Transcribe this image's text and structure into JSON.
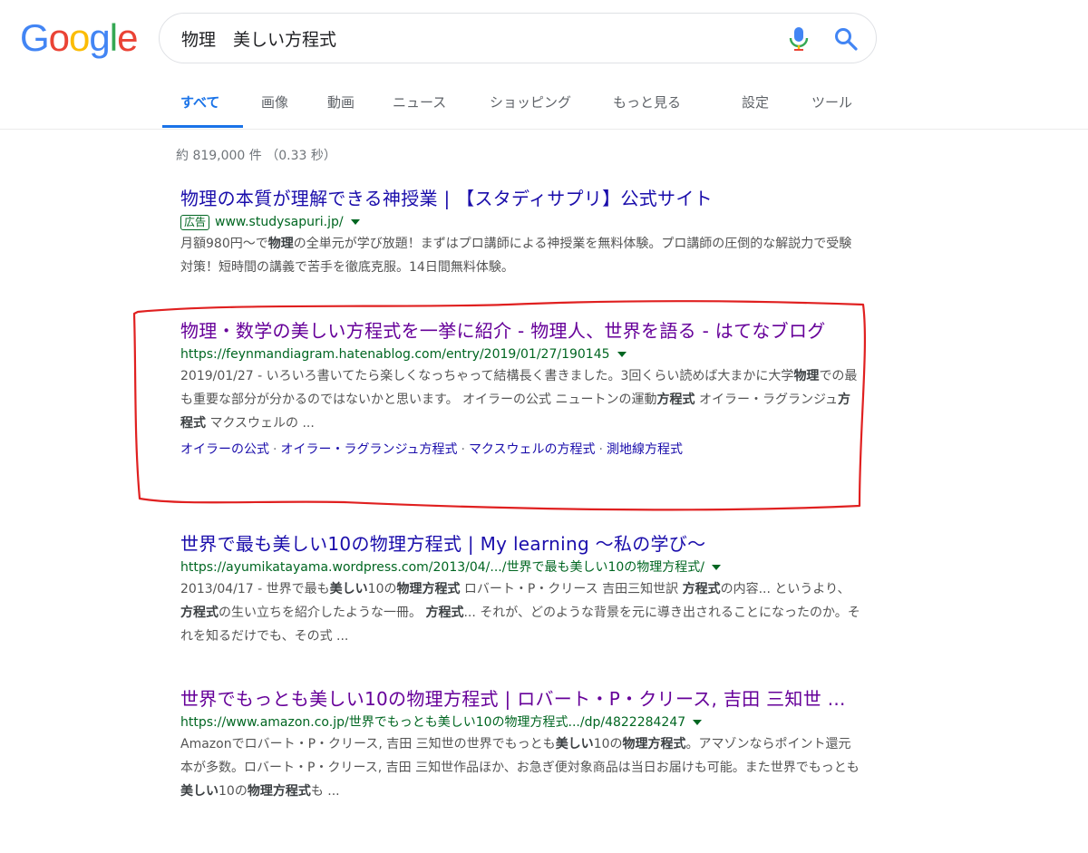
{
  "logo": {
    "letters": [
      "G",
      "o",
      "o",
      "g",
      "l",
      "e"
    ],
    "colors": [
      "#4285F4",
      "#EA4335",
      "#FBBC05",
      "#4285F4",
      "#34A853",
      "#EA4335"
    ]
  },
  "search": {
    "query": "物理　美しい方程式",
    "mic_icon": "mic-icon",
    "search_icon": "search-icon"
  },
  "tabs": [
    "すべて",
    "画像",
    "動画",
    "ニュース",
    "ショッピング",
    "もっと見る",
    "設定",
    "ツール"
  ],
  "stats": "約 819,000 件 （0.33 秒）",
  "results": [
    {
      "title": "物理の本質が理解できる神授業 | 【スタディサプリ】公式サイト",
      "ad_label": "広告",
      "url": "www.studysapuri.jp/",
      "snippet_html": "月額980円～で<b>物理</b>の全単元が学び放題！まずはプロ講師による神授業を無料体験。プロ講師の圧倒的な解説力で受験対策！短時間の講義で苦手を徹底克服。14日間無料体験。"
    },
    {
      "title": "物理・数学の美しい方程式を一挙に紹介 - 物理人、世界を語る - はてなブログ",
      "url": "https://feynmandiagram.hatenablog.com/entry/2019/01/27/190145",
      "snippet_html": "2019/01/27 - いろいろ書いてたら楽しくなっちゃって結構長く書きました。3回くらい読めば大まかに大学<b>物理</b>での最も重要な部分が分かるのではないかと思います。 オイラーの公式 ニュートンの運動<b>方程式</b> オイラー・ラグランジュ<b>方程式</b> マクスウェルの ...",
      "sitelinks": [
        "オイラーの公式",
        "オイラー・ラグランジュ方程式",
        "マクスウェルの方程式",
        "測地線方程式"
      ]
    },
    {
      "title": "世界で最も美しい10の物理方程式 | My learning ～私の学び～",
      "url": "https://ayumikatayama.wordpress.com/2013/04/.../世界で最も美しい10の物理方程式/",
      "snippet_html": "2013/04/17 - 世界で最も<b>美しい</b>10の<b>物理方程式</b> ロバート・P・クリース 吉田三知世訳 <b>方程式</b>の内容... というより、<b>方程式</b>の生い立ちを紹介したような一冊。 <b>方程式</b>... それが、どのような背景を元に導き出されることになったのか。それを知るだけでも、その式 ..."
    },
    {
      "title": "世界でもっとも美しい10の物理方程式 | ロバート・P・クリース, 吉田 三知世 ...",
      "url": "https://www.amazon.co.jp/世界でもっとも美しい10の物理方程式.../dp/4822284247",
      "snippet_html": "Amazonでロバート・P・クリース, 吉田 三知世の世界でもっとも<b>美しい</b>10の<b>物理方程式</b>。アマゾンならポイント還元本が多数。ロバート・P・クリース, 吉田 三知世作品ほか、お急ぎ便対象商品は当日お届けも可能。また世界でもっとも<b>美しい</b>10の<b>物理方程式</b>も ..."
    }
  ]
}
